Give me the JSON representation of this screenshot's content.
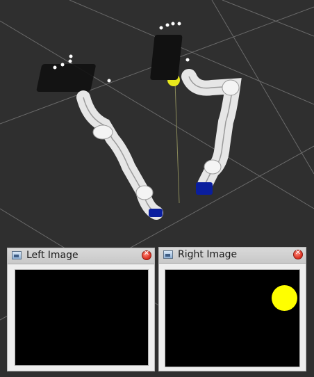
{
  "left_viewer": {
    "title": "Left Image",
    "icon": "image-icon",
    "close_icon": "close-icon"
  },
  "right_viewer": {
    "title": "Right Image",
    "icon": "image-icon",
    "close_icon": "close-icon",
    "detected_object_color": "#ffff00"
  },
  "scene": {
    "background_color": "#2f2f2f",
    "grid_color": "#6a6a6a",
    "target_ball_colors": [
      "#e8e81c",
      "#5aa7c8"
    ],
    "robot_base_color": "#0a1e9e"
  }
}
